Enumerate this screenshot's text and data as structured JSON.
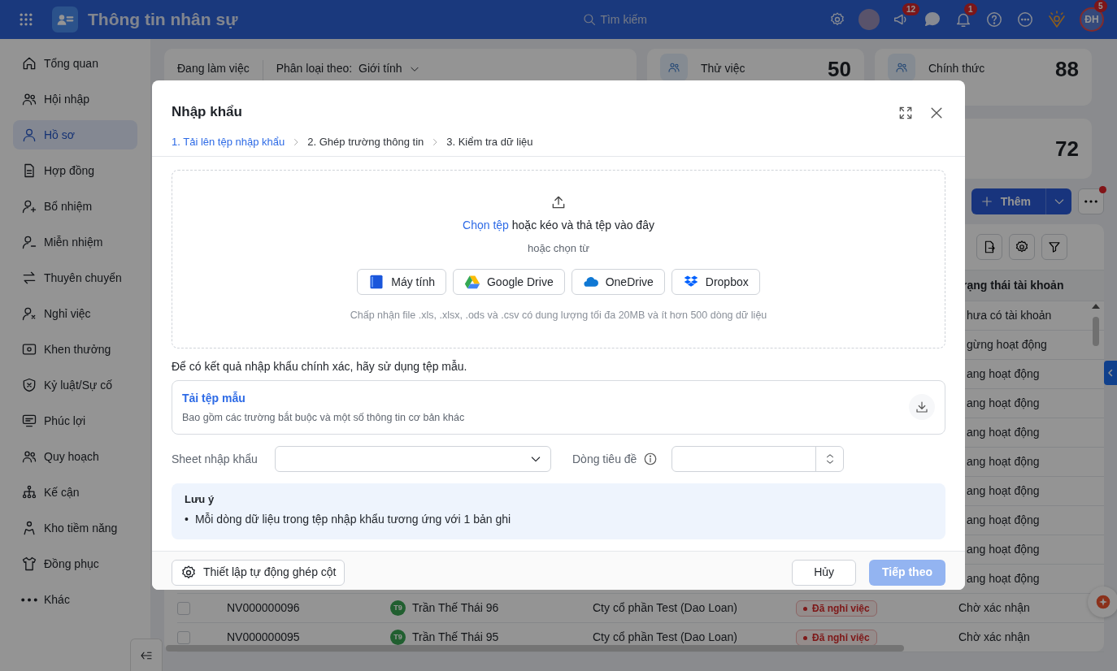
{
  "header": {
    "title": "Thông tin nhân sự",
    "search_placeholder": "Tìm kiếm",
    "announcement_badge": "12",
    "bell_badge": "1",
    "avatar_initials": "ĐH",
    "avatar_badge": "5"
  },
  "sidebar": {
    "items": [
      {
        "label": "Tổng quan",
        "selected": false
      },
      {
        "label": "Hội nhập",
        "selected": false
      },
      {
        "label": "Hồ sơ",
        "selected": true
      },
      {
        "label": "Hợp đồng",
        "selected": false
      },
      {
        "label": "Bổ nhiệm",
        "selected": false
      },
      {
        "label": "Miễn nhiệm",
        "selected": false
      },
      {
        "label": "Thuyên chuyển",
        "selected": false
      },
      {
        "label": "Nghỉ việc",
        "selected": false
      },
      {
        "label": "Khen thưởng",
        "selected": false
      },
      {
        "label": "Kỷ luật/Sự cố",
        "selected": false
      },
      {
        "label": "Phúc lợi",
        "selected": false
      },
      {
        "label": "Quy hoạch",
        "selected": false
      },
      {
        "label": "Kế cận",
        "selected": false
      },
      {
        "label": "Kho tiềm năng",
        "selected": false
      },
      {
        "label": "Đồng phục",
        "selected": false
      },
      {
        "label": "Khác",
        "selected": false
      }
    ]
  },
  "summary": {
    "filter_label": "Đang làm việc",
    "group_by_label": "Phân loại theo:",
    "group_by_value": "Giới tính",
    "stats": [
      {
        "label": "Thử việc",
        "value": "50"
      },
      {
        "label": "Chính thức",
        "value": "88"
      },
      {
        "value": "72"
      }
    ]
  },
  "actions": {
    "add_button": "Thêm"
  },
  "table": {
    "column_header": "rạng thái tài khoản",
    "partial_cells": [
      "hưa có tài khoản",
      "gừng hoạt động",
      "ang hoạt động",
      "ang hoạt động",
      "ang hoạt động",
      "ang hoạt động",
      "ang hoạt động",
      "ang hoạt động",
      "ang hoạt động",
      "ang hoạt động"
    ],
    "rows": [
      {
        "checked": false,
        "code": "NV000000096",
        "avatar": "T9",
        "name": "Trần Thế Thái 96",
        "company": "Cty cổ phần Test (Dao Loan)",
        "status": "Đã nghỉ việc",
        "account": "Chờ xác nhận"
      },
      {
        "checked": false,
        "code": "NV000000095",
        "avatar": "T9",
        "name": "Trần Thế Thái 95",
        "company": "Cty cổ phần Test (Dao Loan)",
        "status": "Đã nghỉ việc",
        "account": "Chờ xác nhận"
      }
    ]
  },
  "modal": {
    "title": "Nhập khẩu",
    "steps": [
      {
        "label": "1. Tải lên tệp nhập khẩu",
        "selected": true
      },
      {
        "label": "2. Ghép trường thông tin",
        "selected": false
      },
      {
        "label": "3. Kiểm tra dữ liệu",
        "selected": false
      }
    ],
    "upload": {
      "link": "Chọn tệp",
      "text": "hoặc kéo và thả tệp vào đây",
      "or_text": "hoặc chọn từ",
      "sources": [
        {
          "label": "Máy tính",
          "kind": "computer"
        },
        {
          "label": "Google Drive",
          "kind": "gdrive"
        },
        {
          "label": "OneDrive",
          "kind": "onedrive"
        },
        {
          "label": "Dropbox",
          "kind": "dropbox"
        }
      ],
      "hint": "Chấp nhận file .xls, .xlsx, .ods và .csv có dung lượng tối đa 20MB và ít hơn 500 dòng dữ liệu"
    },
    "template_note": "Để có kết quả nhập khẩu chính xác, hãy sử dụng tệp mẫu.",
    "template": {
      "title": "Tải tệp mẫu",
      "description": "Bao gồm các trường bắt buộc và một số thông tin cơ bản khác"
    },
    "sheet_label": "Sheet nhập khẩu",
    "header_row_label": "Dòng tiêu đề",
    "note": {
      "title": "Lưu ý",
      "bullet": "•",
      "items": [
        "Mỗi dòng dữ liệu trong tệp nhập khẩu tương ứng với 1 bản ghi"
      ]
    },
    "footer": {
      "auto_map_button": "Thiết lập tự động ghép cột",
      "cancel_button": "Hủy",
      "next_button": {
        "label": "Tiếp theo",
        "disabled": true
      }
    }
  }
}
